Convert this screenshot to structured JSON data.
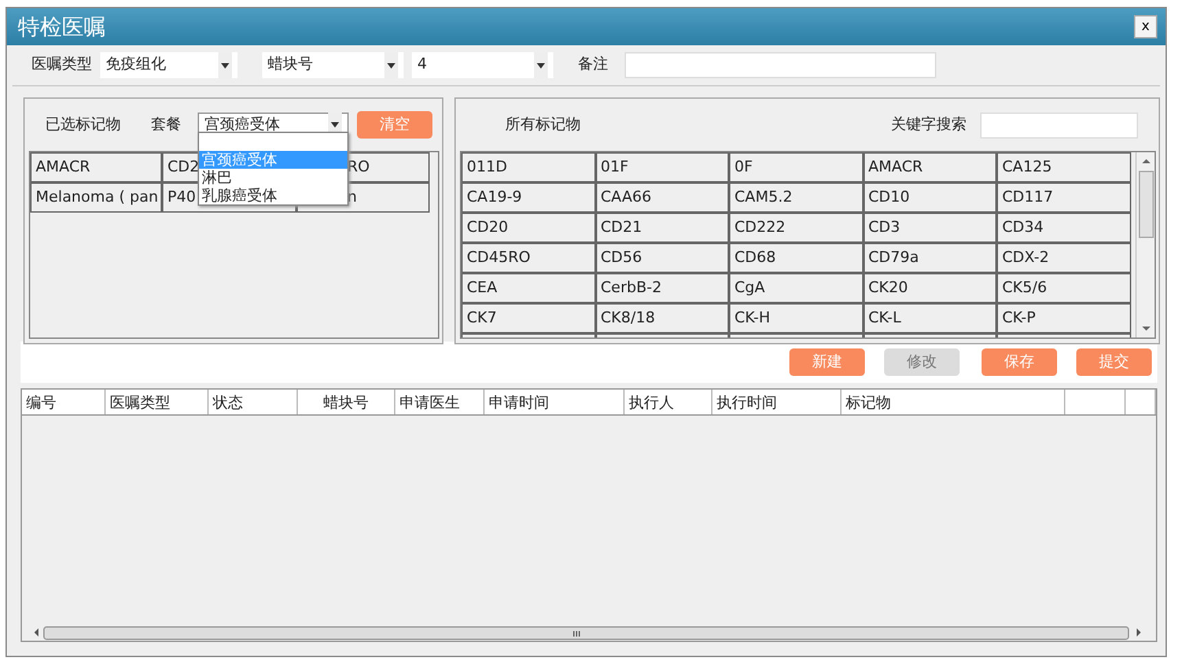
{
  "window": {
    "title": "特检医嘱",
    "close": "x"
  },
  "form": {
    "order_type": {
      "label": "医嘱类型",
      "value": "免疫组化"
    },
    "block": {
      "value": "蜡块号"
    },
    "block_no": {
      "value": "4"
    },
    "remark": {
      "label": "备注"
    }
  },
  "selected_markers": {
    "label": "已选标记物",
    "package_label": "套餐",
    "package_value": "宫颈癌受体",
    "clear_button": "清空",
    "rows": [
      [
        "AMACR",
        "CD2",
        "RO"
      ],
      [
        "Melanoma ( pan",
        "P40",
        "n"
      ]
    ],
    "dropdown": {
      "options": [
        {
          "label": "宫颈癌受体",
          "selected": true
        },
        {
          "label": "淋巴",
          "selected": false
        },
        {
          "label": "乳腺癌受体",
          "selected": false
        }
      ]
    }
  },
  "all_markers": {
    "label": "所有标记物",
    "search_label": "关键字搜索",
    "rows": [
      [
        "011D",
        "01F",
        "0F",
        "AMACR",
        "CA125"
      ],
      [
        "CA19-9",
        "CAA66",
        "CAM5.2",
        "CD10",
        "CD117"
      ],
      [
        "CD20",
        "CD21",
        "CD222",
        "CD3",
        "CD34"
      ],
      [
        "CD45RO",
        "CD56",
        "CD68",
        "CD79a",
        "CDX-2"
      ],
      [
        "CEA",
        "CerbB-2",
        "CgA",
        "CK20",
        "CK5/6"
      ],
      [
        "CK7",
        "CK8/18",
        "CK-H",
        "CK-L",
        "CK-P"
      ]
    ]
  },
  "buttons": [
    {
      "label": "新建",
      "disabled": false
    },
    {
      "label": "修改",
      "disabled": true
    },
    {
      "label": "保存",
      "disabled": false
    },
    {
      "label": "提交",
      "disabled": false
    }
  ],
  "table": {
    "columns": [
      "编号",
      "医嘱类型",
      "状态",
      "蜡块号",
      "申请医生",
      "申请时间",
      "执行人",
      "执行时间",
      "标记物"
    ]
  }
}
